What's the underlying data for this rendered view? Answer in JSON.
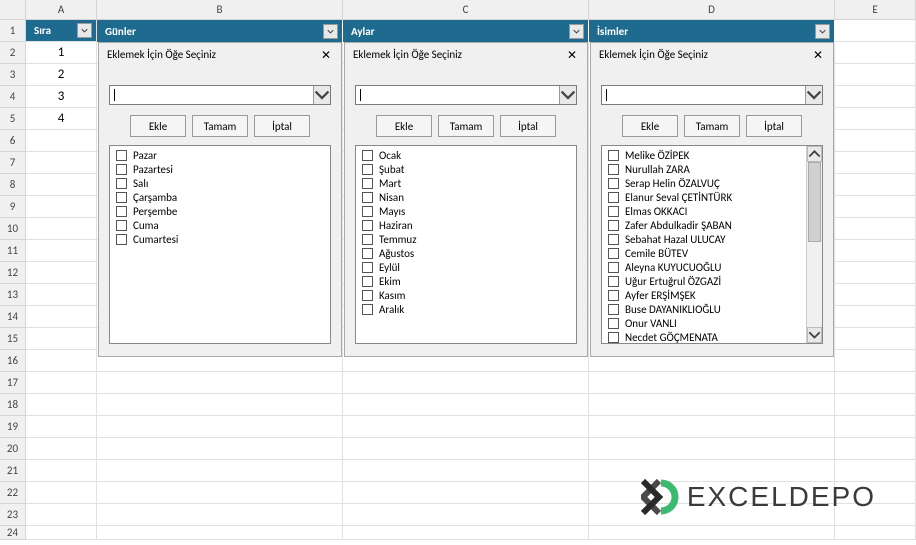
{
  "columns": [
    "A",
    "B",
    "C",
    "D",
    "E"
  ],
  "rows": 24,
  "headers": {
    "sira": "Sıra",
    "gunler": "Günler",
    "aylar": "Aylar",
    "isimler": "İsimler"
  },
  "sira_values": [
    "1",
    "2",
    "3",
    "4"
  ],
  "panels": {
    "title": "Eklemek İçin Öğe Seçiniz",
    "buttons": {
      "ekle": "Ekle",
      "tamam": "Tamam",
      "iptal": "İptal"
    },
    "gunler": [
      "Pazar",
      "Pazartesi",
      "Salı",
      "Çarşamba",
      "Perşembe",
      "Cuma",
      "Cumartesi"
    ],
    "aylar": [
      "Ocak",
      "Şubat",
      "Mart",
      "Nisan",
      "Mayıs",
      "Haziran",
      "Temmuz",
      "Ağustos",
      "Eylül",
      "Ekim",
      "Kasım",
      "Aralık"
    ],
    "isimler": [
      "Melike ÖZİPEK",
      "Nurullah ZARA",
      "Serap Helin ÖZALVUÇ",
      "Elanur Seval ÇETİNTÜRK",
      "Elmas OKKACI",
      "Zafer Abdulkadir ŞABAN",
      "Sebahat Hazal ULUCAY",
      "Cemile BÜTEV",
      "Aleyna KUYUCUOĞLU",
      "Uğur Ertuğrul ÖZGAZİ",
      "Ayfer ERŞİMŞEK",
      "Buse DAYANIKLIOĞLU",
      "Onur VANLI",
      "Necdet GÖÇMENATA"
    ]
  },
  "logo": {
    "text": "EXCELDEPO"
  }
}
